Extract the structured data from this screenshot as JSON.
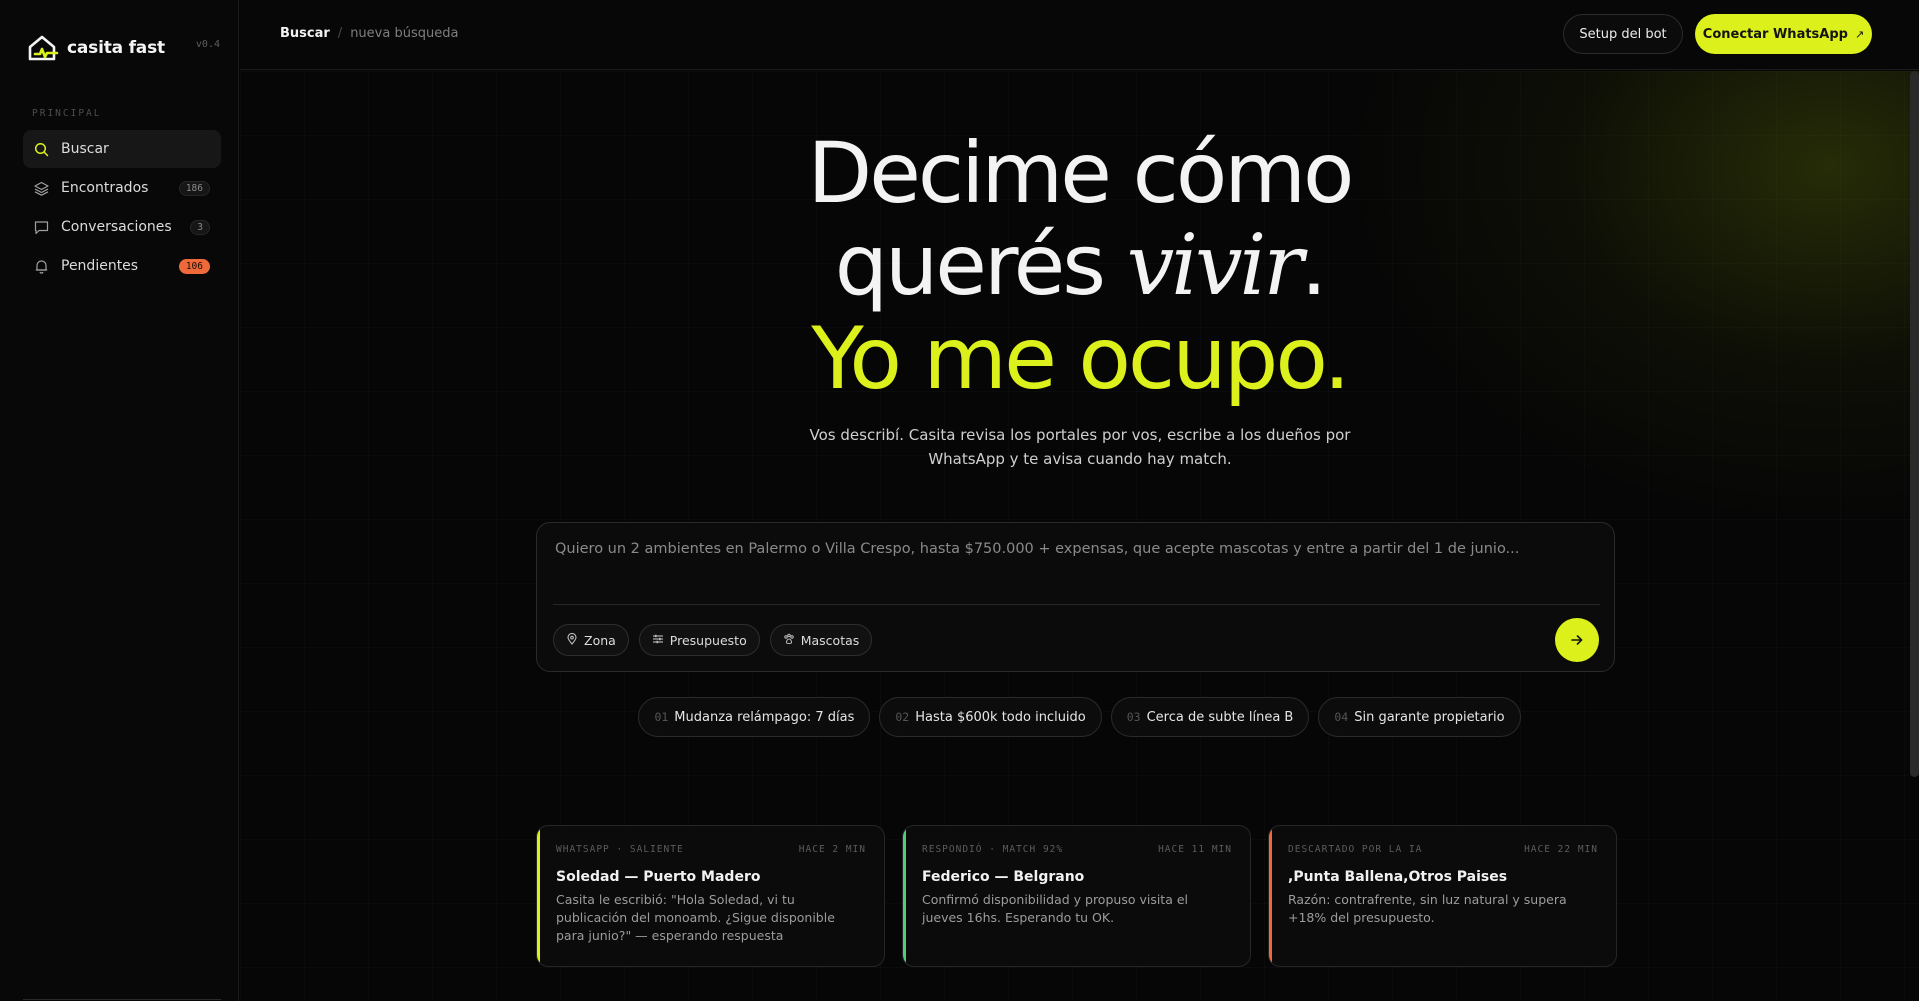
{
  "sidebar": {
    "brand": "casita fast",
    "version": "v0.4",
    "section": "PRINCIPAL",
    "items": [
      {
        "label": "Buscar",
        "icon": "search-icon",
        "count": ""
      },
      {
        "label": "Encontrados",
        "icon": "layers-icon",
        "count": "186"
      },
      {
        "label": "Conversaciones",
        "icon": "chat-icon",
        "count": "3"
      },
      {
        "label": "Pendientes",
        "icon": "bell-icon",
        "count": "106"
      }
    ]
  },
  "topbar": {
    "breadcrumb_current": "Buscar",
    "breadcrumb_separator": "/",
    "breadcrumb_sub": "nueva búsqueda",
    "setup_label": "Setup del bot",
    "whatsapp_label": "Conectar WhatsApp",
    "whatsapp_arrow": "↗"
  },
  "hero": {
    "line1": "Decime cómo",
    "line2_a": "querés ",
    "line2_italic": "vivir",
    "line2_b": ".",
    "line3": "Yo me ocupo.",
    "subtitle": "Vos describí. Casita revisa los portales por vos, escribe a los dueños por WhatsApp y te avisa cuando hay match."
  },
  "composer": {
    "placeholder": "Quiero un 2 ambientes en Palermo o Villa Crespo, hasta $750.000 + expensas, que acepte mascotas y entre a partir del 1 de junio...",
    "chips": [
      {
        "label": "Zona",
        "icon": "pin-icon"
      },
      {
        "label": "Presupuesto",
        "icon": "sliders-icon"
      },
      {
        "label": "Mascotas",
        "icon": "paw-icon"
      }
    ]
  },
  "suggestions": [
    {
      "num": "01",
      "label": "Mudanza relámpago: 7 días"
    },
    {
      "num": "02",
      "label": "Hasta $600k todo incluido"
    },
    {
      "num": "03",
      "label": "Cerca de subte línea B"
    },
    {
      "num": "04",
      "label": "Sin garante propietario"
    }
  ],
  "cards": [
    {
      "meta": "WHATSAPP · SALIENTE",
      "time": "HACE 2 MIN",
      "title": "Soledad — Puerto Madero",
      "text": "Casita le escribió: \"Hola Soledad, vi tu publicación del monoamb. ¿Sigue disponible para junio?\" — esperando respuesta",
      "color": "#dcf01c"
    },
    {
      "meta": "RESPONDIÓ · MATCH 92%",
      "time": "HACE 11 MIN",
      "title": "Federico — Belgrano",
      "text": "Confirmó disponibilidad y propuso visita el jueves 16hs. Esperando tu OK.",
      "color": "#4cd07a"
    },
    {
      "meta": "DESCARTADO POR LA IA",
      "time": "HACE 22 MIN",
      "title": ",Punta Ballena,Otros Paises",
      "text": "Razón: contrafrente, sin luz natural y supera +18% del presupuesto.",
      "color": "#ef6a3b"
    }
  ],
  "colors": {
    "accent": "#dcf01c",
    "alert": "#ef6a3b",
    "success": "#4cd07a"
  }
}
